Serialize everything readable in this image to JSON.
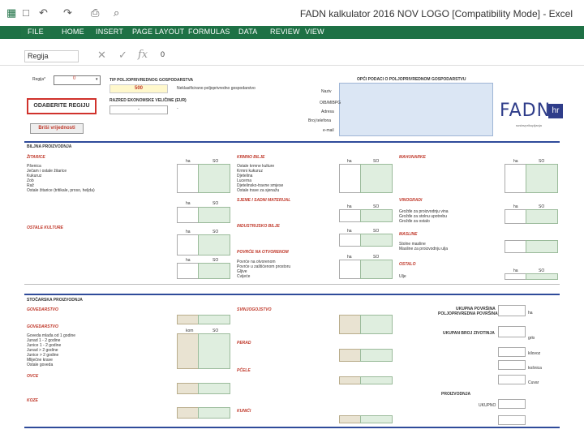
{
  "app": {
    "title": "FADN kalkulator 2016 NOV LOGO [Compatibility Mode] - Excel",
    "quick_access": [
      "▦",
      "□",
      "↶",
      "↷",
      "⎙",
      "⌕"
    ]
  },
  "ribbon": {
    "tabs": [
      "FILE",
      "HOME",
      "INSERT",
      "PAGE LAYOUT",
      "FORMULAS",
      "DATA",
      "REVIEW",
      "VIEW"
    ]
  },
  "formula_bar": {
    "name_box": "Regija",
    "cancel": "✕",
    "enter": "✓",
    "fx": "fx",
    "value": "0"
  },
  "sheet": {
    "regija_label": "Regija*",
    "regija_value": "0",
    "tip_title": "TIP POLJOPRIVREDNOG GOSPODARSTVA",
    "tip_value": "500",
    "tip_note": "Neklasificirano poljoprivredno gospodarstvo",
    "razred_title": "RAZRED EKONOMSKE VELIČINE (EUR)",
    "razred_value": "-",
    "region_button": "ODABERITE REGIJU",
    "clear_button": "Briši vrijednosti",
    "contact_title": "OPĆI PODACI O POLJOPRIVREDNOM GOSPODARSTVU",
    "contact_fields": [
      "Naziv",
      "OIB/MIBPG",
      "Adresa",
      "Broj telefona",
      "e-mail"
    ],
    "logo_text": "FADN",
    "logo_sub": "hr",
    "logo_caption": "sustavprikupljanja",
    "biljna_title": "BILJNA PROIZVODNJA",
    "stocarska_title": "STOČARSKA PROIZVODNJA",
    "col_ha": "ha",
    "col_so": "SO",
    "col_kom": "kom",
    "zitarice_title": "ŽITARICE",
    "zitarice": [
      "Pšenica",
      "Ječam i ostale žitarice",
      "Kukuruz",
      "Zob",
      "Raž",
      "Ostale žitarice (tritikale, proso, heljda)"
    ],
    "krmno_title": "KRMNO BILJE",
    "krmno": [
      "Ostale krmne kulture",
      "Krmni kukuruz",
      "Djetelina",
      "Lucerna",
      "Djetelinsko-travne smjese",
      "Ostale trave za sjenažu"
    ],
    "ostale_title": "OSTALE KULTURE",
    "sjeme_title": "SJEME I SADNI MATERIJAL",
    "mahunarke_title": "MAHUNARKE",
    "industrija_title": "INDUSTRIJSKO BILJE",
    "uljarice_title": "ULJARICE",
    "povrce_title": "POVRĆE NA OTVORENOM",
    "povrce": [
      "Povrće na otvorenom",
      "Povrće u zaštićenom prostoru",
      "Gljive",
      "Cvijeće"
    ],
    "vinogradi_title": "VINOGRADI",
    "vinogradi": [
      "Grožđe za proizvodnju vina",
      "Grožđe za stolnu upotrebu",
      "Grožđe za ostalo"
    ],
    "masline_title": "MASLINE",
    "masline": [
      "Stolne masline",
      "Masline za proizvodnju ulja"
    ],
    "ostalo_title": "OSTALO",
    "ulje_label": "Ulje",
    "stocarska": {
      "govedarstvo_title": "GOVEDARSTVO",
      "goveda": [
        "Goveda mlađa od 1 godine",
        "Junad 1 - 2 godine",
        "Junice 1 - 2 godine",
        "Junad > 2 godine",
        "Junice > 2 godine",
        "Mliječne krave",
        "Ostale goveda"
      ],
      "svinjogojstvo_title": "SVINJOGOJSTVO",
      "ovce_title": "OVCE",
      "koze_title": "KOZE",
      "perad_title": "PERAD",
      "pcele_title": "PČELE",
      "kunici_title": "KUNIĆI",
      "right_labels": [
        "UKUPNA POVRŠINA",
        "POLJOPRIVREDNA POVRŠINA",
        "UKUPAN BROJ ZIVOTINJA",
        "PROIZVODNJA",
        "UKUPNO"
      ],
      "right_units": [
        "ha",
        "grlo",
        "kilovoz",
        "košnica",
        "Cuvar"
      ]
    }
  },
  "colors": {
    "ribbon": "#1e7145",
    "input_green": "#dfeedf",
    "input_beige": "#e9e3d2",
    "section_red": "#c0392b",
    "divider_blue": "#2f4b9a",
    "contact_blue": "#dbe6f4"
  }
}
